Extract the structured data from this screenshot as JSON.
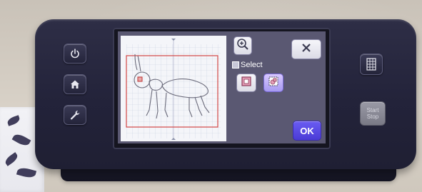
{
  "device": {
    "side_buttons": [
      {
        "name": "power",
        "icon": "power-icon"
      },
      {
        "name": "home",
        "icon": "home-icon"
      },
      {
        "name": "settings",
        "icon": "wrench-icon"
      }
    ],
    "right_buttons": [
      {
        "name": "scan",
        "icon": "scan-grid-icon"
      }
    ],
    "start_stop": {
      "line1": "Start",
      "line2": "Stop"
    }
  },
  "screen": {
    "zoom_icon": "zoom-in-icon",
    "close_icon": "close-icon",
    "select_label": "Select",
    "select_options": [
      {
        "icon": "select-single-icon",
        "selected": false
      },
      {
        "icon": "select-multiple-icon",
        "selected": true
      }
    ],
    "ok_label": "OK",
    "preview_subject": "ant-outline-icon"
  },
  "colors": {
    "accent": "#5a4be0",
    "selected_bg": "#b9a9ff",
    "cut_frame": "#d24545",
    "shape_stroke": "#6a6a7a"
  }
}
